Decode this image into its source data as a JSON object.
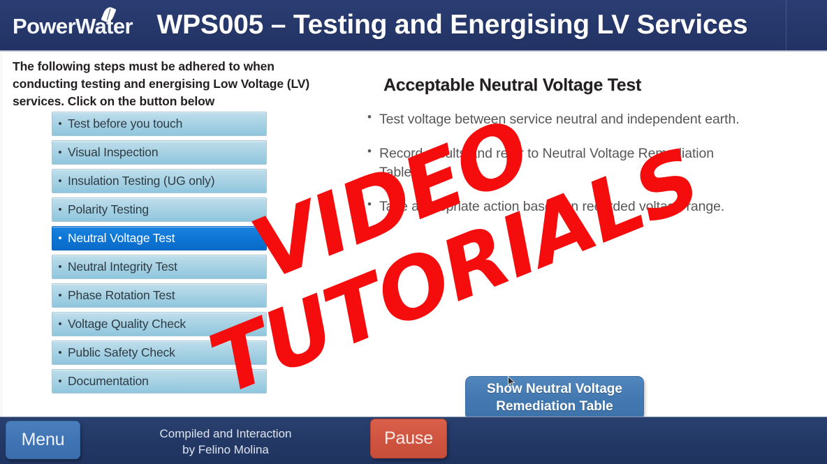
{
  "header": {
    "logo_text": "PowerWater",
    "logo_icon": "leaf-icon",
    "title": "WPS005 – Testing and Energising LV Services"
  },
  "slide": {
    "intro_text": "The following steps must be adhered to when conducting testing and energising Low Voltage (LV) services. Click on the button below",
    "steps": [
      {
        "label": "Test before you touch",
        "selected": false
      },
      {
        "label": "Visual Inspection",
        "selected": false
      },
      {
        "label": "Insulation Testing (UG only)",
        "selected": false
      },
      {
        "label": "Polarity Testing",
        "selected": false
      },
      {
        "label": "Neutral Voltage Test",
        "selected": true
      },
      {
        "label": "Neutral Integrity Test",
        "selected": false
      },
      {
        "label": "Phase Rotation Test",
        "selected": false
      },
      {
        "label": "Voltage Quality Check",
        "selected": false
      },
      {
        "label": "Public Safety Check",
        "selected": false
      },
      {
        "label": "Documentation",
        "selected": false
      }
    ],
    "content": {
      "heading": "Acceptable Neutral Voltage Test",
      "bullets": [
        "Test voltage between service neutral and independent earth.",
        "Record results and refer to Neutral Voltage Remediation Table.",
        "Take appropriate action based on recorded voltage range."
      ],
      "button_line1": "Show Neutral Voltage",
      "button_line2": "Remediation Table"
    }
  },
  "footer": {
    "menu_label": "Menu",
    "credit_line1": "Compiled and Interaction",
    "credit_line2": "by Felino Molina",
    "pause_label": "Pause"
  },
  "watermark": {
    "line1": "VIDEO",
    "line2": "TUTORIALS",
    "color": "#f50d0d"
  },
  "colors": {
    "header_blue": "#27396e",
    "selected_blue": "#0d74d4",
    "step_blue": "#a8d2e4",
    "button_blue": "#4379b1",
    "pause_red": "#cf5440"
  }
}
